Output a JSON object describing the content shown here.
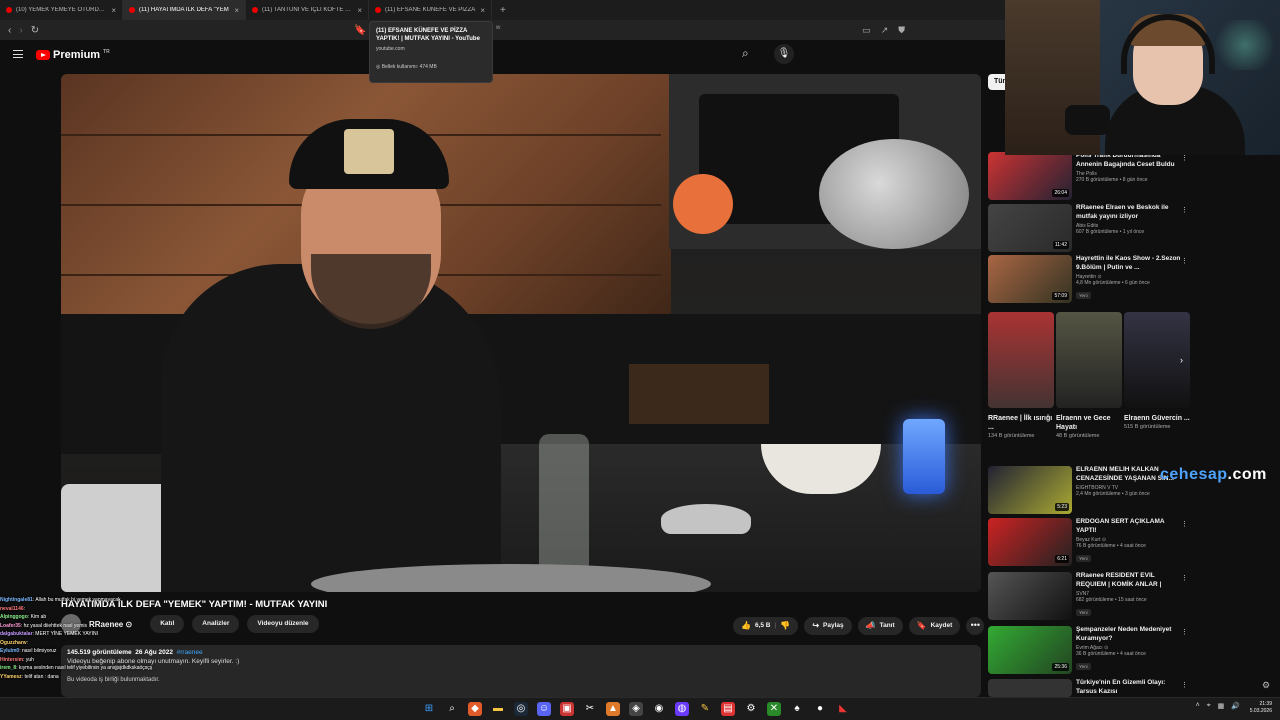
{
  "browser": {
    "tabs": [
      {
        "label": "(10) YEMEK YEMEYE OTURDUK, AZA",
        "active": false
      },
      {
        "label": "(11) HAYATIMDA İLK DEFA \"YEM",
        "active": true
      },
      {
        "label": "(11) TANTUNİ VE İÇLİ KÖFTE YAPTIK",
        "active": false
      },
      {
        "label": "(11) EFSANE KÜNEFE VE PİZZA",
        "active": false
      }
    ],
    "new_tab": "+",
    "url_tail": "w",
    "tooltip": {
      "title": "(11) EFSANE KÜNEFE VE PİZZA YAPTIK! | MUTFAK YAYINI - YouTube",
      "url": "youtube.com",
      "memory": "Bellek kullanımı: 474 MB"
    }
  },
  "youtube": {
    "logo": "Premium",
    "logo_sup": "TR"
  },
  "video": {
    "title": "HAYATIMDA İLK DEFA \"YEMEK\" YAPTIM! - MUTFAK YAYINI",
    "channel": "RRaenee",
    "channel_badge": "⊙",
    "join": "Katıl",
    "analytics": "Analizler",
    "edit_video": "Videoyu düzenle",
    "likes": "6,5 B",
    "share": "Paylaş",
    "promote": "Tanıt",
    "save": "Kaydet",
    "more": "•••",
    "views": "145.519 görüntüleme",
    "date": "26 Ağu 2022",
    "hashtag": "#rraenee",
    "desc_line": "Videoyu beğenip abone olmayı unutmayın. Keyifli seyirler. :)",
    "desc_more": "Bu videoda iş birliği bulunmaktadır."
  },
  "chat": [
    {
      "user": "Nightingale81",
      "msg": "Allah bu mutfak bi yemek yapmayacak"
    },
    {
      "user": "neval1146",
      "msg": ""
    },
    {
      "user": "Alpinggogo",
      "msg": "Kim ab"
    },
    {
      "user": "Loafer35",
      "msg": "hz yasal  diiehttek nasl yemis"
    },
    {
      "user": "dalgabuktalar",
      "msg": "MERT YİNE YEMEK YAYINI"
    },
    {
      "user": "Oguzzhanv",
      "msg": ""
    },
    {
      "user": "Eylulm0",
      "msg": "nasıl bilmiyoruz"
    },
    {
      "user": "Hintersim",
      "msg": "yuh"
    },
    {
      "user": "irem_8",
      "msg": "kıyma seslnden nasıl telif yiyebilirsin ya ansjjsjdkdkskaöçsçş"
    },
    {
      "user": "YYamesz",
      "msg": "telif atan : dana"
    }
  ],
  "sidebar": {
    "chip": "Tüm",
    "recs_top": [
      {
        "title": "Polis Trafik Durdurmasında Annenin Bagajında Ceset Buldu",
        "channel": "The Polis",
        "meta": "270 B görüntüleme • 8 gün önce",
        "dur": "26:04",
        "new": ""
      },
      {
        "title": "RRaenee Elraen ve Beskok ile mutfak yayını izliyor",
        "channel": "Abis Edits",
        "meta": "607 B görüntüleme • 1 yıl önce",
        "dur": "11:42",
        "new": ""
      },
      {
        "title": "Hayrettin ile Kaos Show - 2.Sezon 9.Bölüm | Putin ve ...",
        "channel": "Hayrettin ⊙",
        "meta": "4,8 Mn görüntüleme • 6 gün önce",
        "dur": "57:09",
        "new": "Yeni"
      }
    ],
    "shorts": [
      {
        "title": "RRaenee | İlk ısırığı ...",
        "views": "134 B görüntüleme"
      },
      {
        "title": "Elraenn ve Gece Hayatı",
        "views": "48 B görüntüleme"
      },
      {
        "title": "Elraenn Güvercin ...",
        "views": "515 B görüntüleme"
      }
    ],
    "recs_bottom": [
      {
        "title": "ELRAENN MELİH KALKAN CENAZESİNDE YAŞANAN SIN...",
        "channel": "EIGHTBORN V TV",
        "meta": "2,4 Mn görüntüleme • 3 gün önce",
        "dur": "5:23",
        "new": ""
      },
      {
        "title": "ERDOĞAN SERT AÇIKLAMA YAPTI!",
        "channel": "Beyaz Kurt ⊙",
        "meta": "76 B görüntüleme • 4 saat önce",
        "dur": "6:21",
        "new": "Yeni"
      },
      {
        "title": "RRaenee RESIDENT EVIL REQUIEM | KOMİK ANLAR |",
        "channel": "SVN7",
        "meta": "682 görüntüleme • 15 saat önce",
        "dur": "",
        "new": "Yeni"
      },
      {
        "title": "Şempanzeler Neden Medeniyet Kuramıyor?",
        "channel": "Evrim Ağacı ⊙",
        "meta": "36 B görüntüleme • 4 saat önce",
        "dur": "25:36",
        "new": "Yeni"
      },
      {
        "title": "Türkiye'nin En Gizemli Olayı: Tarsus Kazısı",
        "channel": "",
        "meta": "",
        "dur": "",
        "new": ""
      }
    ]
  },
  "watermark": {
    "brand": "cehesap",
    "dot": ".com"
  },
  "taskbar": {
    "clock_time": "21:39",
    "clock_date": "5.03.2026"
  }
}
